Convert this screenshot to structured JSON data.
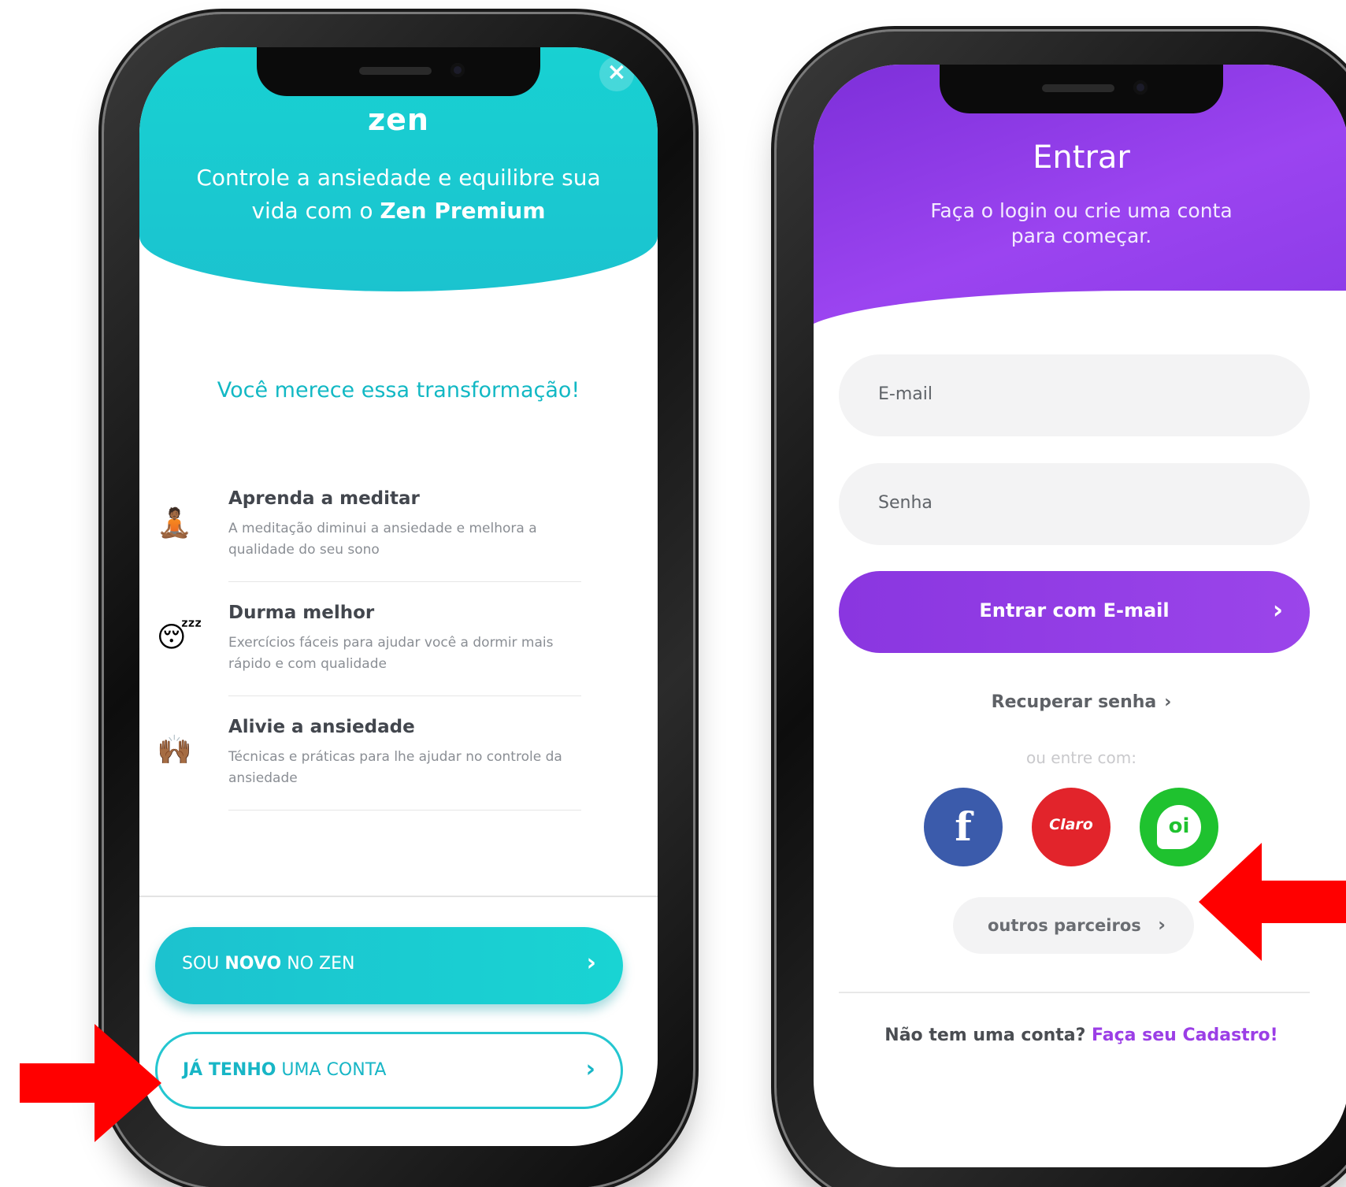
{
  "left_screen": {
    "close_glyph": "×",
    "logo": "zen",
    "headline": {
      "part1": "Controle a ansiedade e equilibre sua vida com o ",
      "bold": "Zen Premium"
    },
    "subtitle": "Você merece essa transformação!",
    "features": [
      {
        "icon": "meditation-emoji",
        "emoji": "🧘🏾",
        "title": "Aprenda a meditar",
        "description": "A meditação diminui a ansiedade e melhora a qualidade do seu sono"
      },
      {
        "icon": "sleeping-face-emoji",
        "emoji": "😴",
        "title": "Durma melhor",
        "description": "Exercícios fáceis para ajudar você a dormir mais rápido e com qualidade"
      },
      {
        "icon": "raised-hands-emoji",
        "emoji": "🙌🏾",
        "title": "Alivie a ansiedade",
        "description": "Técnicas e práticas para lhe ajudar no controle da ansiedade"
      }
    ],
    "btn_new": {
      "pre": "SOU ",
      "bold": "NOVO",
      "post": " NO ZEN",
      "chevron": "›"
    },
    "btn_account": {
      "bold": "JÁ TENHO",
      "post": " UMA CONTA",
      "chevron": "›"
    },
    "colors": {
      "accent": "#19d4d3",
      "text_accent": "#12b8c4"
    }
  },
  "right_screen": {
    "title": "Entrar",
    "subtitle": "Faça o login ou crie uma conta para começar.",
    "email_placeholder": "E-mail",
    "password_placeholder": "Senha",
    "btn_entrar": {
      "label": "Entrar com E-mail",
      "chevron": "›"
    },
    "recover": {
      "label": "Recuperar senha",
      "chevron": "›"
    },
    "or_label": "ou entre com:",
    "social": [
      {
        "name": "facebook",
        "icon": "facebook-icon",
        "glyph": "f",
        "color": "#3b5bab"
      },
      {
        "name": "claro",
        "icon": "claro-logo-icon",
        "glyph": "Claro",
        "color": "#e2242b"
      },
      {
        "name": "oi",
        "icon": "oi-logo-icon",
        "glyph": "oi",
        "color": "#1fc22f"
      }
    ],
    "btn_outros": {
      "label": "outros parceiros",
      "chevron": "›"
    },
    "signup": {
      "text": "Não tem uma conta? ",
      "link": "Faça seu Cadastro!"
    },
    "colors": {
      "accent": "#9b45ea"
    }
  },
  "annotations": {
    "arrow_color": "#ff0000",
    "arrows": [
      "arrow-pointing-right",
      "arrow-pointing-left"
    ]
  }
}
